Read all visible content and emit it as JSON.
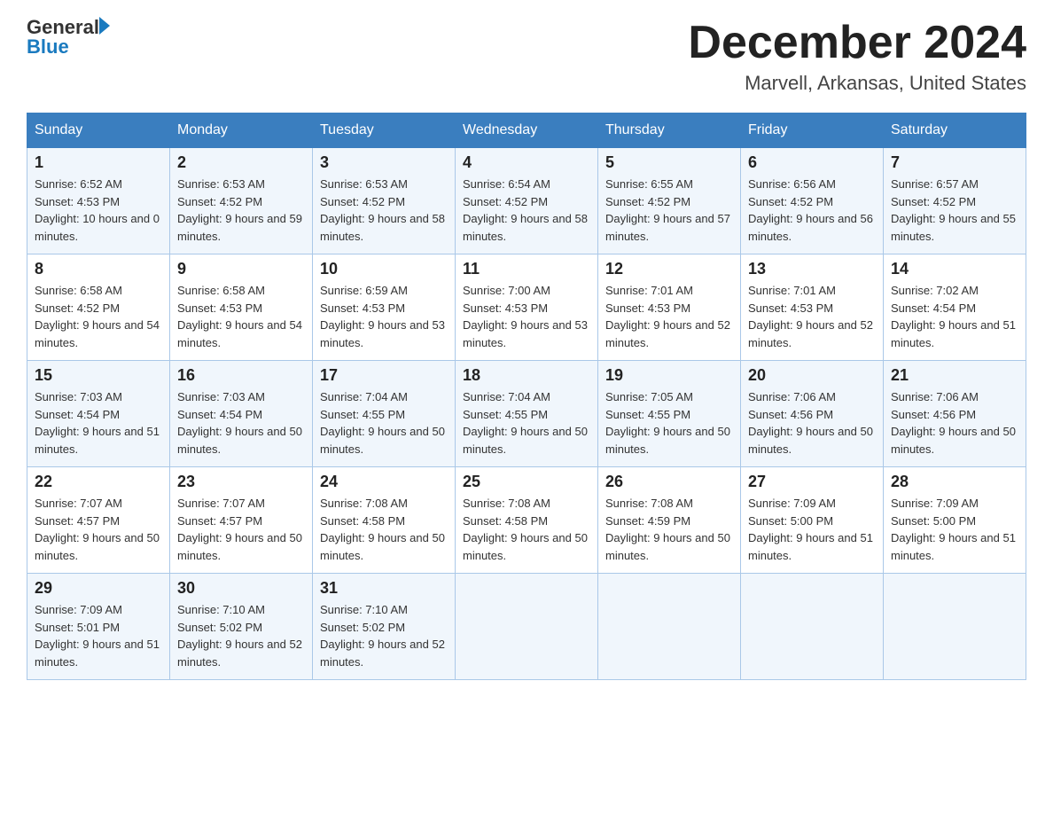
{
  "logo": {
    "text_general": "General",
    "text_blue": "Blue"
  },
  "header": {
    "month": "December 2024",
    "location": "Marvell, Arkansas, United States"
  },
  "weekdays": [
    "Sunday",
    "Monday",
    "Tuesday",
    "Wednesday",
    "Thursday",
    "Friday",
    "Saturday"
  ],
  "weeks": [
    [
      {
        "day": "1",
        "sunrise": "6:52 AM",
        "sunset": "4:53 PM",
        "daylight": "10 hours and 0 minutes."
      },
      {
        "day": "2",
        "sunrise": "6:53 AM",
        "sunset": "4:52 PM",
        "daylight": "9 hours and 59 minutes."
      },
      {
        "day": "3",
        "sunrise": "6:53 AM",
        "sunset": "4:52 PM",
        "daylight": "9 hours and 58 minutes."
      },
      {
        "day": "4",
        "sunrise": "6:54 AM",
        "sunset": "4:52 PM",
        "daylight": "9 hours and 58 minutes."
      },
      {
        "day": "5",
        "sunrise": "6:55 AM",
        "sunset": "4:52 PM",
        "daylight": "9 hours and 57 minutes."
      },
      {
        "day": "6",
        "sunrise": "6:56 AM",
        "sunset": "4:52 PM",
        "daylight": "9 hours and 56 minutes."
      },
      {
        "day": "7",
        "sunrise": "6:57 AM",
        "sunset": "4:52 PM",
        "daylight": "9 hours and 55 minutes."
      }
    ],
    [
      {
        "day": "8",
        "sunrise": "6:58 AM",
        "sunset": "4:52 PM",
        "daylight": "9 hours and 54 minutes."
      },
      {
        "day": "9",
        "sunrise": "6:58 AM",
        "sunset": "4:53 PM",
        "daylight": "9 hours and 54 minutes."
      },
      {
        "day": "10",
        "sunrise": "6:59 AM",
        "sunset": "4:53 PM",
        "daylight": "9 hours and 53 minutes."
      },
      {
        "day": "11",
        "sunrise": "7:00 AM",
        "sunset": "4:53 PM",
        "daylight": "9 hours and 53 minutes."
      },
      {
        "day": "12",
        "sunrise": "7:01 AM",
        "sunset": "4:53 PM",
        "daylight": "9 hours and 52 minutes."
      },
      {
        "day": "13",
        "sunrise": "7:01 AM",
        "sunset": "4:53 PM",
        "daylight": "9 hours and 52 minutes."
      },
      {
        "day": "14",
        "sunrise": "7:02 AM",
        "sunset": "4:54 PM",
        "daylight": "9 hours and 51 minutes."
      }
    ],
    [
      {
        "day": "15",
        "sunrise": "7:03 AM",
        "sunset": "4:54 PM",
        "daylight": "9 hours and 51 minutes."
      },
      {
        "day": "16",
        "sunrise": "7:03 AM",
        "sunset": "4:54 PM",
        "daylight": "9 hours and 50 minutes."
      },
      {
        "day": "17",
        "sunrise": "7:04 AM",
        "sunset": "4:55 PM",
        "daylight": "9 hours and 50 minutes."
      },
      {
        "day": "18",
        "sunrise": "7:04 AM",
        "sunset": "4:55 PM",
        "daylight": "9 hours and 50 minutes."
      },
      {
        "day": "19",
        "sunrise": "7:05 AM",
        "sunset": "4:55 PM",
        "daylight": "9 hours and 50 minutes."
      },
      {
        "day": "20",
        "sunrise": "7:06 AM",
        "sunset": "4:56 PM",
        "daylight": "9 hours and 50 minutes."
      },
      {
        "day": "21",
        "sunrise": "7:06 AM",
        "sunset": "4:56 PM",
        "daylight": "9 hours and 50 minutes."
      }
    ],
    [
      {
        "day": "22",
        "sunrise": "7:07 AM",
        "sunset": "4:57 PM",
        "daylight": "9 hours and 50 minutes."
      },
      {
        "day": "23",
        "sunrise": "7:07 AM",
        "sunset": "4:57 PM",
        "daylight": "9 hours and 50 minutes."
      },
      {
        "day": "24",
        "sunrise": "7:08 AM",
        "sunset": "4:58 PM",
        "daylight": "9 hours and 50 minutes."
      },
      {
        "day": "25",
        "sunrise": "7:08 AM",
        "sunset": "4:58 PM",
        "daylight": "9 hours and 50 minutes."
      },
      {
        "day": "26",
        "sunrise": "7:08 AM",
        "sunset": "4:59 PM",
        "daylight": "9 hours and 50 minutes."
      },
      {
        "day": "27",
        "sunrise": "7:09 AM",
        "sunset": "5:00 PM",
        "daylight": "9 hours and 51 minutes."
      },
      {
        "day": "28",
        "sunrise": "7:09 AM",
        "sunset": "5:00 PM",
        "daylight": "9 hours and 51 minutes."
      }
    ],
    [
      {
        "day": "29",
        "sunrise": "7:09 AM",
        "sunset": "5:01 PM",
        "daylight": "9 hours and 51 minutes."
      },
      {
        "day": "30",
        "sunrise": "7:10 AM",
        "sunset": "5:02 PM",
        "daylight": "9 hours and 52 minutes."
      },
      {
        "day": "31",
        "sunrise": "7:10 AM",
        "sunset": "5:02 PM",
        "daylight": "9 hours and 52 minutes."
      },
      null,
      null,
      null,
      null
    ]
  ]
}
